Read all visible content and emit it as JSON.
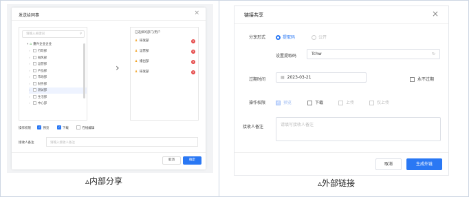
{
  "internal": {
    "title": "发送给同事",
    "search_placeholder": "请输入关键词",
    "root_label": "嘉兴企业企业",
    "tree_items": [
      "行政部",
      "微风部",
      "运营部",
      "产品部",
      "市场部",
      "财务部",
      "测试部",
      "生活部",
      "中心部"
    ],
    "selected_header": "已选择的部门/用户",
    "selected_users": [
      "研发部",
      "运营部",
      "播出部",
      "研发部"
    ],
    "perm_label": "操作权限",
    "perm_options": [
      "预览",
      "下载",
      "在线编辑"
    ],
    "note_label": "接收人备注",
    "note_placeholder": "请输入接收人备注",
    "cancel_label": "取消",
    "ok_label": "确定",
    "caption": "▵内部分享"
  },
  "external": {
    "title": "链接共享",
    "share_type_label": "分享形式",
    "share_type_options": [
      "提取码",
      "公开"
    ],
    "code_label": "设置提取码",
    "code_value": "Tchw",
    "expire_label": "过期时间",
    "expire_value": "2023-03-21",
    "never_expire_label": "永不过期",
    "perm_label": "操作权限",
    "perm_options": [
      "预览",
      "下载",
      "上传",
      "仅上传"
    ],
    "note_label": "接收人备注",
    "note_placeholder": "请填写接收人备注",
    "cancel_label": "取消",
    "ok_label": "生成外链",
    "caption": "▵外部链接"
  },
  "colors": {
    "accent": "#2a78f4",
    "danger": "#e54b4b",
    "user_icon": "#f0a020"
  }
}
